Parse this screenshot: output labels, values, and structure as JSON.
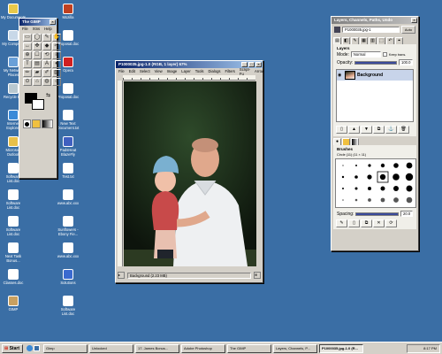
{
  "desktop": {
    "icons": [
      {
        "label": "My Documents",
        "color": "#e8c94a"
      },
      {
        "label": "My Computer",
        "color": "#c8d8e8"
      },
      {
        "label": "My Network Places",
        "color": "#6aa0d8"
      },
      {
        "label": "Recycle Bin",
        "color": "#b8c8d0"
      },
      {
        "label": "Internet Explorer",
        "color": "#3a8ad8"
      },
      {
        "label": "Microsoft Outlook",
        "color": "#e8c04a"
      },
      {
        "label": "Software List.doc",
        "color": "#ffffff"
      },
      {
        "label": "Software List.doc",
        "color": "#ffffff"
      },
      {
        "label": "Software List.doc",
        "color": "#ffffff"
      },
      {
        "label": "Next Task Bonus...",
        "color": "#ffffff"
      },
      {
        "label": "Classes.doc",
        "color": "#ffffff"
      },
      {
        "label": "GIMP",
        "color": "#c8a060"
      },
      {
        "label": "Mozilla",
        "color": "#c04020"
      },
      {
        "label": "Proposal.doc",
        "color": "#ffffff"
      },
      {
        "label": "Opera",
        "color": "#d02020"
      },
      {
        "label": "Proposal.doc",
        "color": "#ffffff"
      },
      {
        "label": "New Text Document.txt",
        "color": "#ffffff"
      },
      {
        "label": "PadsHeat BlazeFly",
        "color": "#4060c0"
      },
      {
        "label": "Test.txt",
        "color": "#ffffff"
      },
      {
        "label": "www.abc.xxx",
        "color": "#ffffff"
      },
      {
        "label": "Sunflowers - Ebony Fie...",
        "color": "#ffffff"
      },
      {
        "label": "www.abc.xxx",
        "color": "#ffffff"
      },
      {
        "label": "Solutions",
        "color": "#3a6ad0"
      },
      {
        "label": "Software List.doc",
        "color": "#ffffff"
      }
    ]
  },
  "toolbox": {
    "title": "The GIMP",
    "menus": [
      "File",
      "Xtns",
      "Help"
    ],
    "tool_glyphs": [
      "▭",
      "◯",
      "✎",
      "✋",
      "↔",
      "✥",
      "◆",
      "✂",
      "⊕",
      "☐",
      "⟲",
      "≡",
      "T",
      "▤",
      "A",
      "◐",
      "✏",
      "▰",
      "✐",
      "▨",
      "⊙",
      "⌂",
      "◍",
      "☼"
    ],
    "fg_color": "#000000",
    "bg_color": "#ffffff"
  },
  "image_window": {
    "title": "P1000035.jpg-1.0 (RGB, 1 layer) 67%",
    "menus": [
      "File",
      "Edit",
      "Select",
      "View",
      "Image",
      "Layer",
      "Tools",
      "Dialogs",
      "Filters",
      "Script-Fu",
      "Arrow"
    ],
    "status": "Background (2.23 MB)",
    "zoom_label": "67%"
  },
  "dock": {
    "title": "Layers, Channels, Paths, Undo",
    "image_menu": "P1000035.jpg-1",
    "auto_label": "Auto",
    "layers_header": "Layers",
    "mode_label": "Mode:",
    "mode_value": "Normal",
    "keep_trans_label": "Keep trans.",
    "opacity_label": "Opacity:",
    "opacity_value": "100.0",
    "layer_name": "Background",
    "brushes_header": "Brushes",
    "brush_name": "Circle (11) (11 × 11)",
    "spacing_label": "Spacing:",
    "spacing_value": "20.0"
  },
  "taskbar": {
    "start_label": "Start",
    "buttons": [
      {
        "label": "Gimp",
        "active": false
      },
      {
        "label": "Unlocked",
        "active": false
      },
      {
        "label": "17. James Bonus...",
        "active": false
      },
      {
        "label": "Adobe Photoshop",
        "active": false
      },
      {
        "label": "The GIMP",
        "active": false
      },
      {
        "label": "Layers, Channels, P...",
        "active": false
      },
      {
        "label": "P1000035.jpg-1.0 (R...",
        "active": true
      }
    ],
    "clock": "8:17 PM"
  }
}
